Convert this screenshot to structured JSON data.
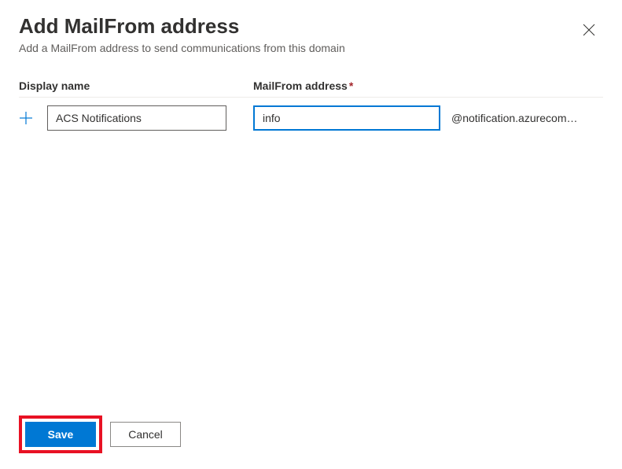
{
  "header": {
    "title": "Add MailFrom address",
    "subtitle": "Add a MailFrom address to send communications from this domain"
  },
  "form": {
    "display_name_label": "Display name",
    "mailfrom_label": "MailFrom address",
    "display_name_value": "ACS Notifications",
    "mailfrom_value": "info",
    "domain_suffix": "@notification.azurecom…"
  },
  "footer": {
    "save_label": "Save",
    "cancel_label": "Cancel"
  }
}
